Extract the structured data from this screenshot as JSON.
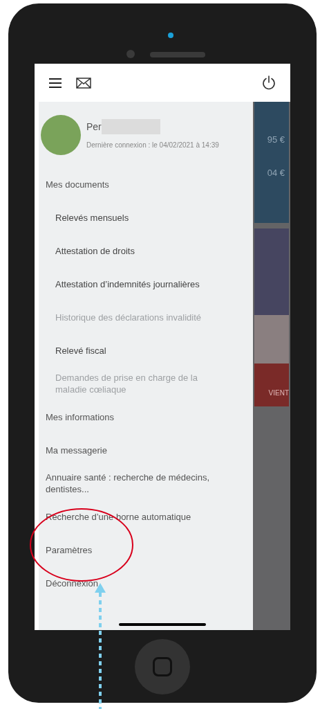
{
  "user": {
    "name": "Per",
    "last_login": "Dernière connexion : le 04/02/2021 à 14:39"
  },
  "menu": [
    {
      "kind": "section",
      "label": "Mes documents",
      "disabled": false
    },
    {
      "kind": "sub",
      "label": "Relevés mensuels",
      "disabled": false
    },
    {
      "kind": "sub",
      "label": "Attestation de droits",
      "disabled": false
    },
    {
      "kind": "sub",
      "label": "Attestation d’indemnités journalières",
      "disabled": false
    },
    {
      "kind": "sub",
      "label": "Historique des déclarations invalidité",
      "disabled": true
    },
    {
      "kind": "sub",
      "label": "Relevé fiscal",
      "disabled": false
    },
    {
      "kind": "sub",
      "label": "Demandes de prise en charge de la maladie cœliaque",
      "disabled": true
    },
    {
      "kind": "section",
      "label": "Mes informations",
      "disabled": false
    },
    {
      "kind": "section",
      "label": "Ma messagerie",
      "disabled": false
    },
    {
      "kind": "section",
      "label": "Annuaire santé : recherche de médecins, dentistes...",
      "disabled": false
    },
    {
      "kind": "section",
      "label": "Recherche d’une borne automatique",
      "disabled": false
    },
    {
      "kind": "section",
      "label": "Paramètres",
      "disabled": false
    },
    {
      "kind": "section",
      "label": "Déconnexion",
      "disabled": false
    }
  ],
  "background": {
    "amounts": [
      "95 €",
      "04 €"
    ],
    "banner": "VIENT"
  }
}
